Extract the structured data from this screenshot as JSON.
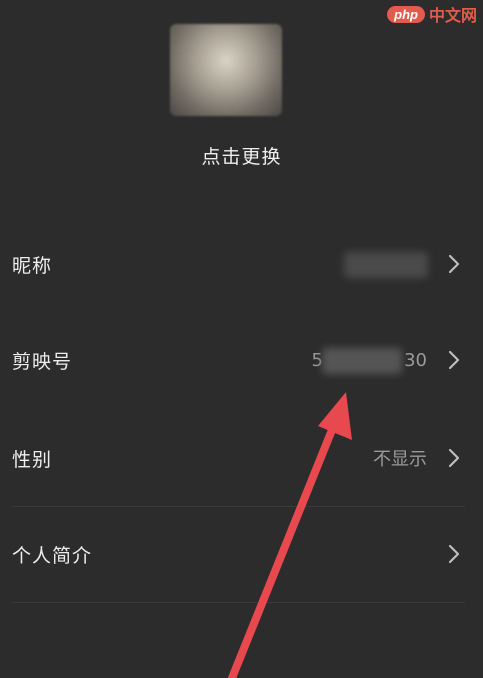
{
  "watermark": {
    "php": "php",
    "site": "中文网"
  },
  "profile": {
    "change_avatar": "点击更换"
  },
  "rows": [
    {
      "label": "昵称",
      "value": ""
    },
    {
      "label": "剪映号",
      "value_prefix": "5",
      "value_suffix": "30"
    },
    {
      "label": "性别",
      "value": "不显示"
    },
    {
      "label": "个人简介",
      "value": ""
    }
  ],
  "colors": {
    "background": "#2c2c2c",
    "arrow": "#e8494f",
    "watermark": "#e25b4c"
  }
}
